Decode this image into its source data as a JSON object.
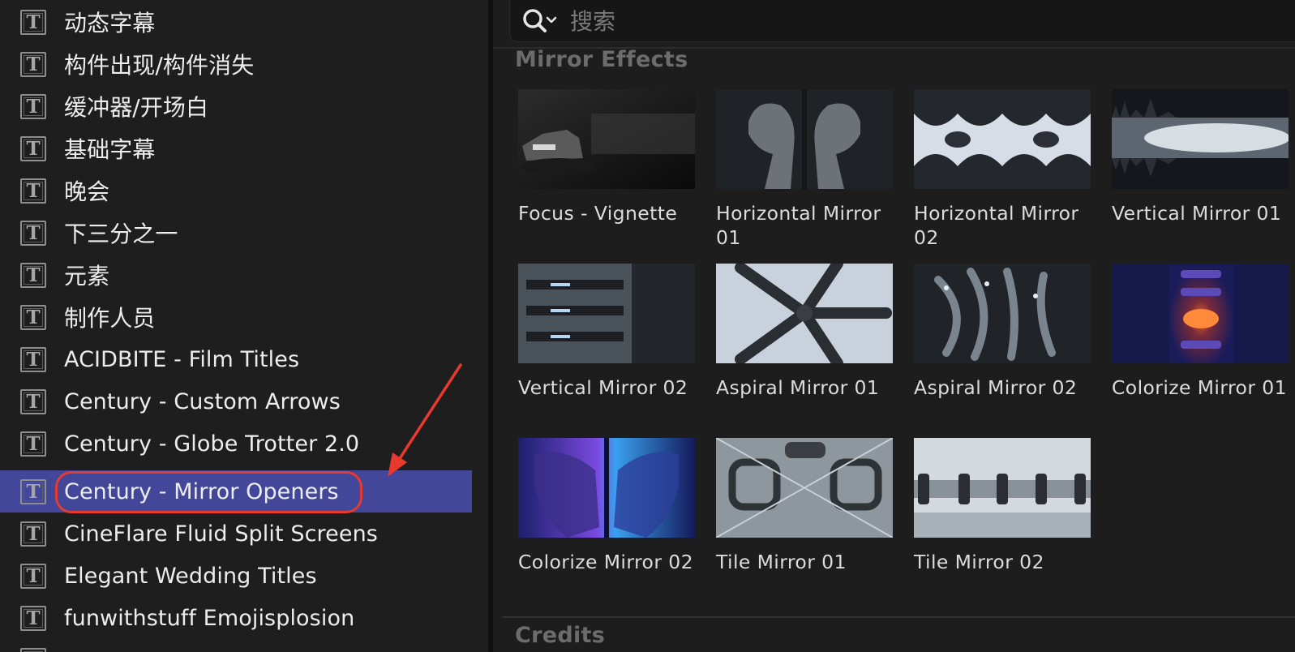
{
  "sidebar": {
    "items": [
      {
        "label": "动态字幕",
        "icon": "title-t-icon"
      },
      {
        "label": "构件出现/构件消失",
        "icon": "title-t-icon"
      },
      {
        "label": "缓冲器/开场白",
        "icon": "title-t-icon"
      },
      {
        "label": "基础字幕",
        "icon": "title-t-icon"
      },
      {
        "label": "晚会",
        "icon": "title-t-icon"
      },
      {
        "label": "下三分之一",
        "icon": "title-t-icon"
      },
      {
        "label": "元素",
        "icon": "title-t-icon"
      },
      {
        "label": "制作人员",
        "icon": "title-t-icon"
      },
      {
        "label": "ACIDBITE - Film Titles",
        "icon": "title-t-icon"
      },
      {
        "label": "Century - Custom Arrows",
        "icon": "title-t-icon"
      },
      {
        "label": "Century - Globe Trotter 2.0",
        "icon": "title-t-icon"
      },
      {
        "label": "Century - Mirror Openers",
        "icon": "title-t-icon",
        "selected": true
      },
      {
        "label": "CineFlare Fluid Split Screens",
        "icon": "title-t-icon"
      },
      {
        "label": "Elegant Wedding Titles",
        "icon": "title-t-icon"
      },
      {
        "label": "funwithstuff Emojisplosion",
        "icon": "title-t-icon"
      }
    ],
    "t_glyph": "T",
    "selected_color": "#43479a"
  },
  "search": {
    "placeholder": "搜索",
    "value": "",
    "icon": "search-icon"
  },
  "sections": [
    {
      "title": "Mirror Effects",
      "tiles": [
        {
          "label": "Focus - Vignette"
        },
        {
          "label": "Horizontal Mirror 01"
        },
        {
          "label": "Horizontal Mirror 02"
        },
        {
          "label": "Vertical Mirror 01"
        },
        {
          "label": "Vertical Mirror 02"
        },
        {
          "label": "Aspiral Mirror 01"
        },
        {
          "label": "Aspiral Mirror 02"
        },
        {
          "label": "Colorize Mirror 01"
        },
        {
          "label": "Colorize Mirror 02"
        },
        {
          "label": "Tile Mirror 01"
        },
        {
          "label": "Tile Mirror 02"
        }
      ]
    },
    {
      "title": "Credits",
      "tiles": []
    }
  ],
  "colors": {
    "annotation": "#e8392e",
    "section_title": "#6c6c6c"
  }
}
